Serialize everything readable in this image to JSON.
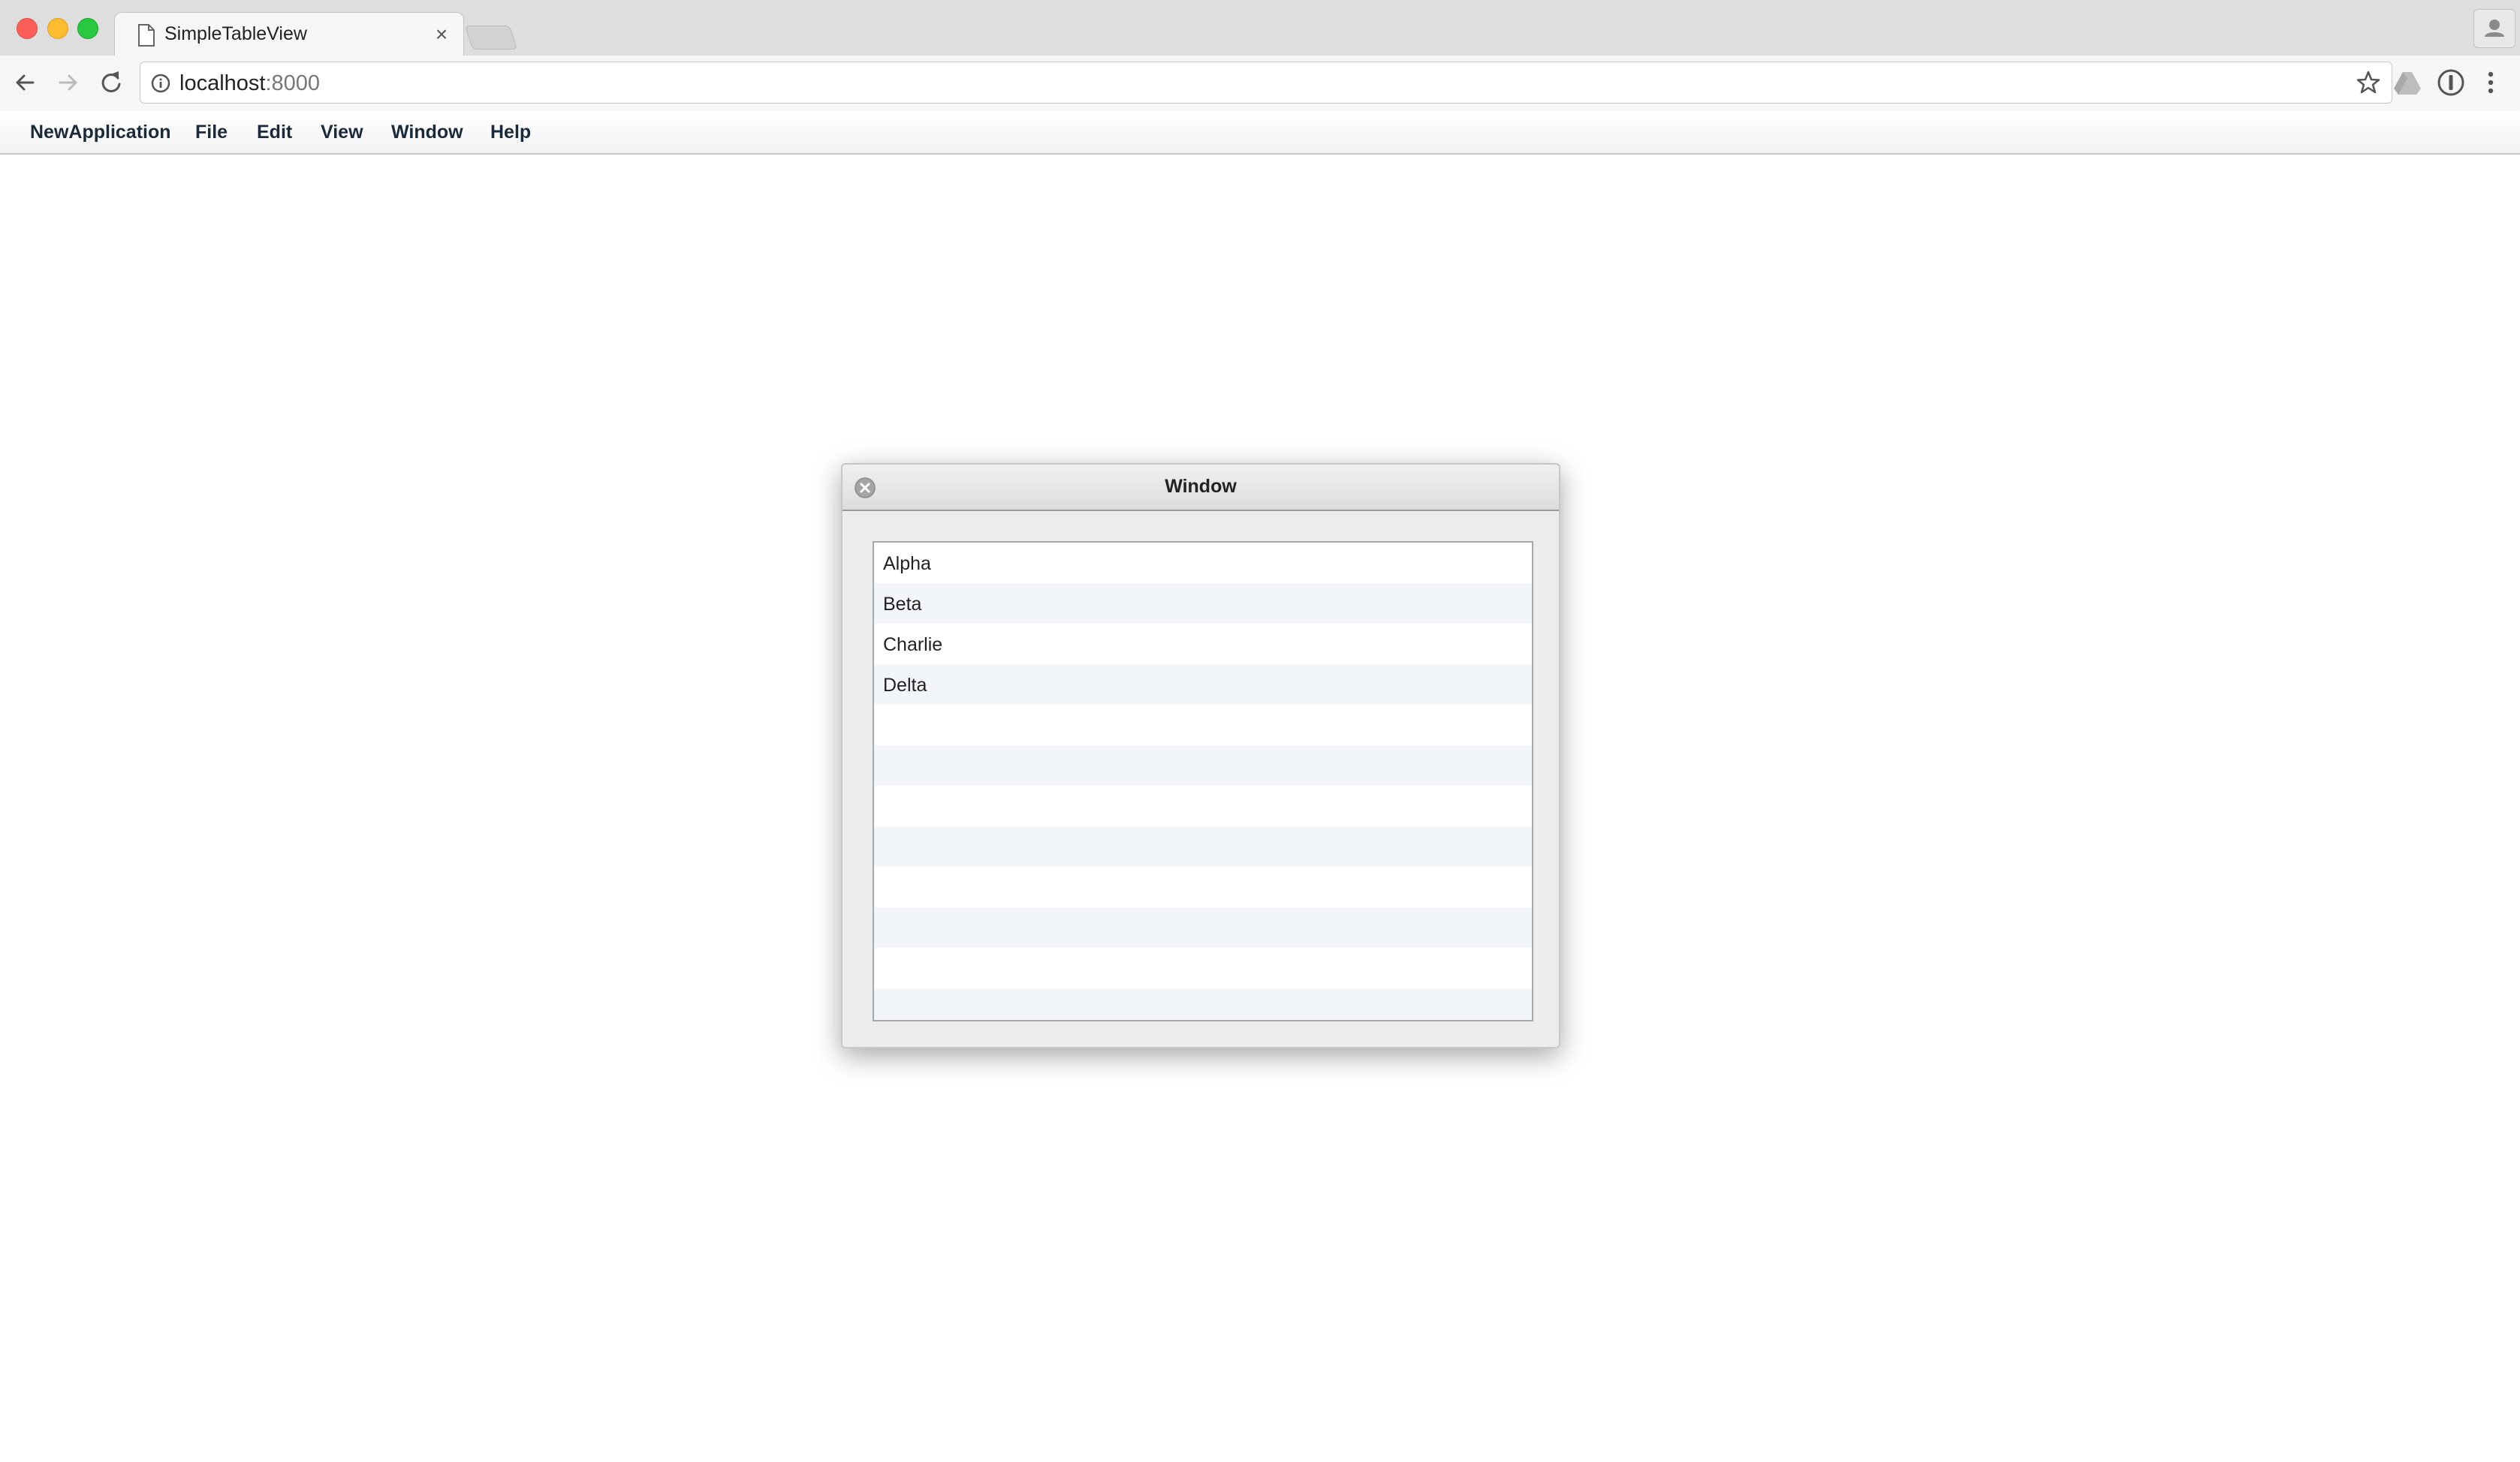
{
  "browser": {
    "tab_title": "SimpleTableView",
    "tab_close": "×",
    "url_host": "localhost",
    "url_port": ":8000"
  },
  "app_menu": {
    "items": [
      "NewApplication",
      "File",
      "Edit",
      "View",
      "Window",
      "Help"
    ]
  },
  "window": {
    "title": "Window",
    "table": {
      "rows": [
        "Alpha",
        "Beta",
        "Charlie",
        "Delta",
        "",
        "",
        "",
        "",
        "",
        "",
        "",
        ""
      ]
    }
  }
}
